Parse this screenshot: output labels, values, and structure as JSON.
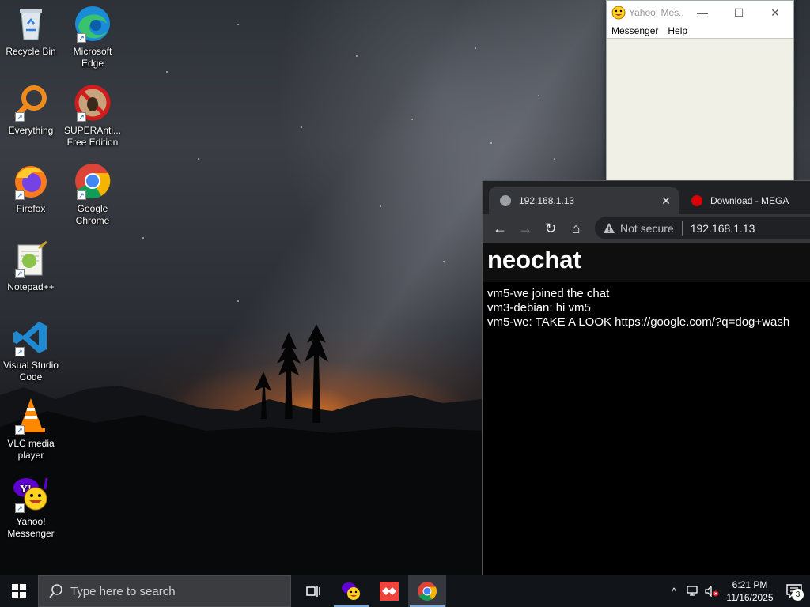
{
  "desktop": {
    "icons": [
      {
        "label": "Recycle Bin",
        "icon": "recycle-bin-icon"
      },
      {
        "label": "Microsoft Edge",
        "icon": "edge-icon"
      },
      {
        "label": "Everything",
        "icon": "everything-icon"
      },
      {
        "label": "SUPERAnti... Free Edition",
        "icon": "superantispyware-icon"
      },
      {
        "label": "Firefox",
        "icon": "firefox-icon"
      },
      {
        "label": "Google Chrome",
        "icon": "chrome-icon"
      },
      {
        "label": "Notepad++",
        "icon": "notepadpp-icon"
      },
      {
        "label": "Visual Studio Code",
        "icon": "vscode-icon"
      },
      {
        "label": "VLC media player",
        "icon": "vlc-icon"
      },
      {
        "label": "Yahoo! Messenger",
        "icon": "yahoo-messenger-icon"
      }
    ]
  },
  "yahoo_window": {
    "title": "Yahoo! Mes...",
    "menu": [
      "Messenger",
      "Help"
    ],
    "controls": {
      "minimize": "—",
      "maximize": "☐",
      "close": "✕"
    }
  },
  "chrome": {
    "tabs": [
      {
        "label": "192.168.1.13",
        "active": true
      },
      {
        "label": "Download - MEGA",
        "active": false
      }
    ],
    "tab_close": "✕",
    "omnibox": {
      "security": "Not secure",
      "url": "192.168.1.13"
    },
    "nav": {
      "back": "←",
      "forward": "→",
      "reload": "↻",
      "home": "⌂"
    },
    "page": {
      "title": "neochat",
      "messages": [
        "vm5-we joined the chat",
        "vm3-debian: hi vm5",
        "vm5-we: TAKE A LOOK https://google.com/?q=dog+wash"
      ]
    }
  },
  "taskbar": {
    "search_placeholder": "Type here to search",
    "apps": [
      "task-view",
      "yahoo-messenger",
      "anydesk",
      "chrome"
    ],
    "time": "6:21 PM",
    "date": "11/16/2025",
    "notification_count": "3",
    "tray": {
      "show_hidden": "^"
    }
  },
  "colors": {
    "taskbar": "#111418",
    "chrome_frame": "#202124",
    "chrome_toolbar": "#35363a",
    "yahoo_purple": "#5f01d1",
    "accent_underline": "#7aa9e0"
  }
}
